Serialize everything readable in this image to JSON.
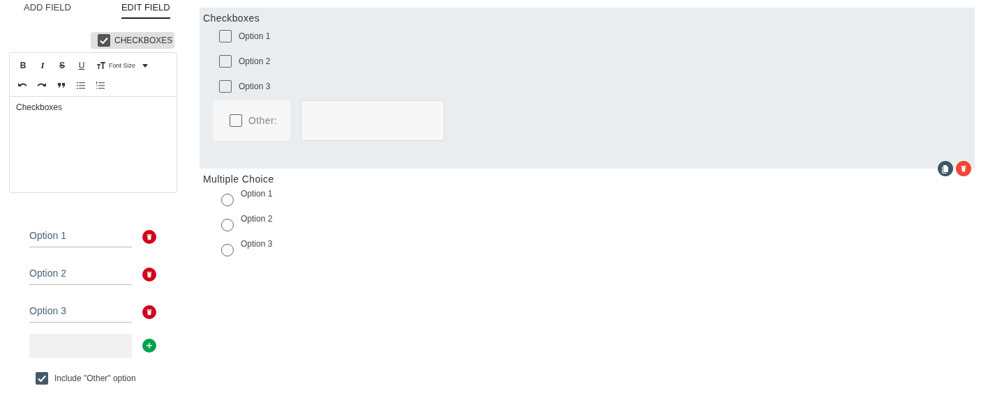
{
  "tabs": [
    {
      "label": "ADD FIELD",
      "selected": false
    },
    {
      "label": "EDIT FIELD",
      "selected": true
    }
  ],
  "field_type_chip": {
    "label": "CHECKBOXES",
    "checked": true
  },
  "editor": {
    "toolbar_rows": [
      [
        {
          "kind": "bold",
          "glyph": "B"
        },
        {
          "kind": "italic",
          "glyph": "I"
        },
        {
          "kind": "strike",
          "glyph": "S"
        },
        {
          "kind": "underline",
          "glyph": "U"
        },
        {
          "kind": "font-size",
          "label": "Font Size"
        }
      ],
      [
        {
          "kind": "undo"
        },
        {
          "kind": "redo"
        },
        {
          "kind": "quote"
        },
        {
          "kind": "bullet-list"
        },
        {
          "kind": "numbered-list"
        }
      ]
    ],
    "content": "Checkboxes"
  },
  "options": [
    {
      "value": "Option 1"
    },
    {
      "value": "Option 2"
    },
    {
      "value": "Option 3"
    }
  ],
  "include_other": {
    "label": "Include \"Other\" option",
    "checked": true
  },
  "preview_fields": [
    {
      "kind": "checkboxes",
      "title": "Checkboxes",
      "active": true,
      "options": [
        {
          "label": "Option 1",
          "checked": false
        },
        {
          "label": "Option 2",
          "checked": false
        },
        {
          "label": "Option 3",
          "checked": false
        }
      ],
      "other": {
        "label": "Other:",
        "checked": false
      }
    },
    {
      "kind": "multiple-choice",
      "title": "Multiple Choice",
      "active": false,
      "options": [
        {
          "label": "Option 1",
          "selected": false
        },
        {
          "label": "Option 2",
          "selected": false
        },
        {
          "label": "Option 3",
          "selected": false
        }
      ]
    }
  ]
}
